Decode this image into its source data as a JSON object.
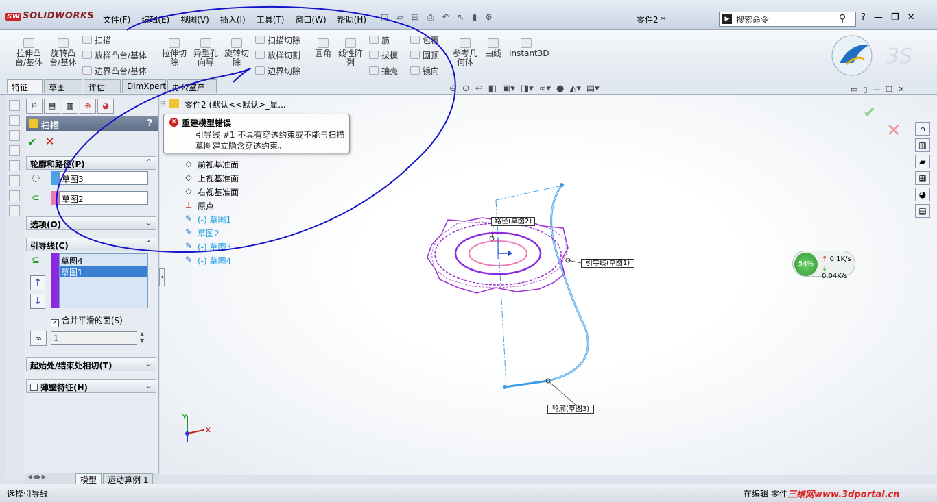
{
  "app": {
    "logo": "SOLIDWORKS",
    "doc_title": "零件2 *"
  },
  "menu": [
    "文件(F)",
    "编辑(E)",
    "视图(V)",
    "插入(I)",
    "工具(T)",
    "窗口(W)",
    "帮助(H)"
  ],
  "search": {
    "placeholder": "搜索命令"
  },
  "ribbon": {
    "extrude_boss": "拉伸凸\n台/基体",
    "revolve_boss": "旋转凸\n台/基体",
    "sweep": "扫描",
    "loft_boss": "放样凸台/基体",
    "boundary_boss": "边界凸台/基体",
    "extrude_cut": "拉伸切\n除",
    "hole_wizard": "异型孔\n向导",
    "revolve_cut": "旋转切\n除",
    "swept_cut": "扫描切除",
    "lofted_cut": "放样切割",
    "boundary_cut": "边界切除",
    "fillet": "圆角",
    "linear_pattern": "线性阵\n列",
    "rib": "筋",
    "draft": "拔模",
    "shell": "抽壳",
    "wrap": "包覆",
    "dome": "圆顶",
    "mirror": "镜向",
    "ref_geometry": "参考几\n何体",
    "curves": "曲线",
    "instant3d": "Instant3D"
  },
  "tabs": [
    "特征",
    "草图",
    "评估",
    "DimXpert",
    "办公室产品"
  ],
  "pm": {
    "title": "扫描",
    "help": "?",
    "section_profile": "轮廓和路径(P)",
    "profile_field": "草图3",
    "path_field": "草图2",
    "section_options": "选项(O)",
    "section_guides": "引导线(C)",
    "guides": [
      "草图4",
      "草图1"
    ],
    "merge_faces": "合并平滑的面(S)",
    "spin_value": "1",
    "section_tangency": "起始处/结束处相切(T)",
    "section_thin": "薄壁特征(H)"
  },
  "tree": {
    "root": "零件2 (默认<<默认>_显...",
    "front_plane": "前视基准面",
    "top_plane": "上视基准面",
    "right_plane": "右视基准面",
    "origin": "原点",
    "sketch1": "(-) 草图1",
    "sketch2": "草图2",
    "sketch3": "(-) 草图3",
    "sketch4": "(-) 草图4"
  },
  "error_tip": {
    "title": "重建模型错误",
    "body": "引导线 #1 不具有穿透约束或不能与扫描草图建立隐含穿透约束。"
  },
  "callouts": {
    "path": "路径(草图2)",
    "guide": "引导线(草图1)",
    "profile": "轮廓(草图3)"
  },
  "axes": {
    "x": "X",
    "y": "Y"
  },
  "net": {
    "percent": "54%",
    "up": "0.1K/s",
    "down": "0.04K/s"
  },
  "bottom_tabs": [
    "模型",
    "运动算例 1"
  ],
  "status": {
    "left": "选择引导线",
    "right": "在编辑 零件",
    "watermark": "三维网www.3dportal.cn"
  },
  "colors": {
    "profile_swatch": "#4aa3e8",
    "path_swatch": "#f07ab4",
    "guide_swatch": "#8a2be2",
    "sketch_blue": "#3c9be6",
    "path_purple": "#9b30d0",
    "pink": "#f07ab4"
  }
}
